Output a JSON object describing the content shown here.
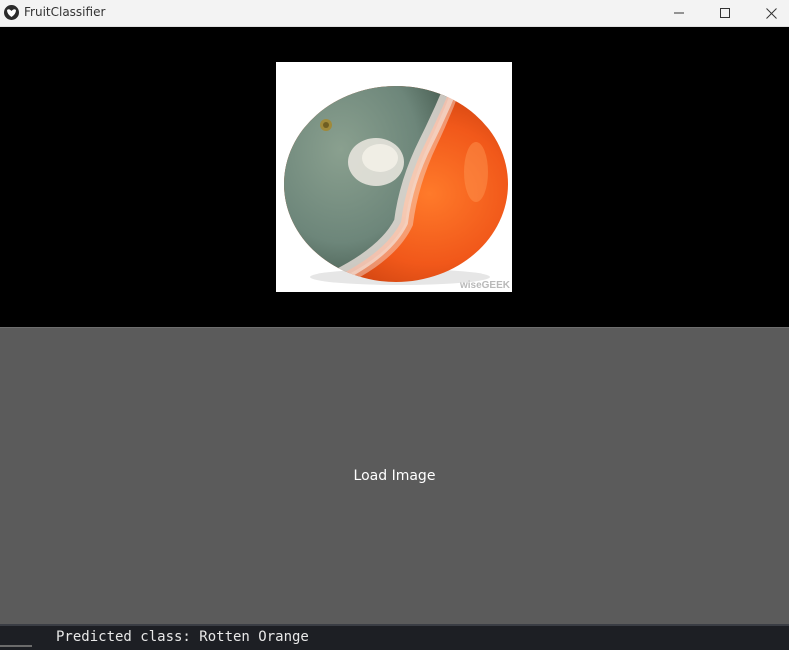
{
  "window": {
    "title": "FruitClassifier",
    "app_icon": "app-logo-icon",
    "controls": {
      "minimize_icon": "minimize-icon",
      "maximize_icon": "maximize-icon",
      "close_icon": "close-icon"
    }
  },
  "image_panel": {
    "subject": "rotten-orange-photo",
    "watermark": "wiseGEEK"
  },
  "load_button": {
    "label": "Load Image"
  },
  "status": {
    "prediction_text": "Predicted class: Rotten Orange"
  },
  "colors": {
    "titlebar_bg": "#f3f3f3",
    "canvas_bg": "#000000",
    "button_bg": "#5b5b5b",
    "status_bg": "#1d1f24"
  }
}
